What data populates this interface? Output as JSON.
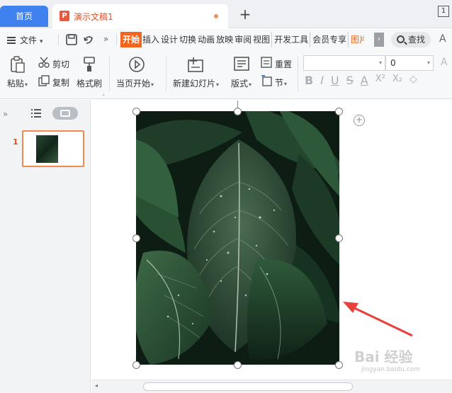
{
  "tabs": {
    "home": "首页",
    "doc_title": "演示文稿1",
    "add_tab": "+",
    "window_num": "1"
  },
  "menu": {
    "file": "文件",
    "items": [
      "开始",
      "插入",
      "设计",
      "切换",
      "动画",
      "放映",
      "审阅",
      "视图",
      "开发工具",
      "会员专享",
      "图片"
    ],
    "search": "查找"
  },
  "ribbon": {
    "paste": "粘贴",
    "cut": "剪切",
    "copy": "复制",
    "format_painter": "格式刷",
    "start_from_current": "当页开始",
    "new_slide": "新建幻灯片",
    "layout": "版式",
    "reset": "重置",
    "section": "节",
    "font_name": "",
    "font_size": "0",
    "bold": "B",
    "italic": "I",
    "underline": "U",
    "strikethrough": "S",
    "font_color": "A",
    "superscript": "X²",
    "subscript": "X₂"
  },
  "panel": {
    "slide_number": "1"
  },
  "watermark": {
    "main": "Bai 经验",
    "sub": "jingyan.baidu.com"
  },
  "colors": {
    "accent": "#f2651d",
    "home_tab": "#3f82ef",
    "arrow": "#e8403a"
  }
}
